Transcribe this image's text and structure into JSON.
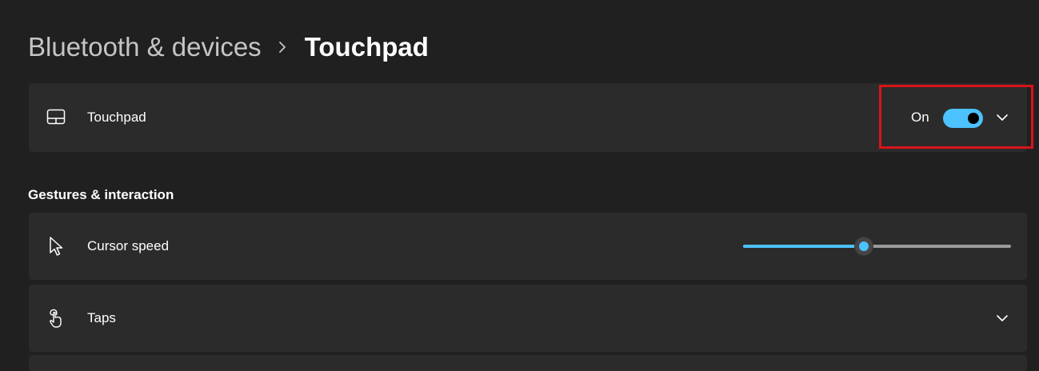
{
  "breadcrumb": {
    "parent": "Bluetooth & devices",
    "current": "Touchpad"
  },
  "touchpad_card": {
    "label": "Touchpad",
    "icon": "touchpad-icon",
    "state_text": "On",
    "toggle_on": true
  },
  "section": {
    "title": "Gestures & interaction"
  },
  "cursor_card": {
    "label": "Cursor speed",
    "icon": "cursor-icon",
    "slider_fraction": 0.45
  },
  "taps_card": {
    "label": "Taps",
    "icon": "tap-gesture-icon"
  },
  "colors": {
    "accent": "#4cc2ff",
    "highlight": "#d9141a",
    "background": "#202020",
    "card": "#2b2b2b"
  }
}
